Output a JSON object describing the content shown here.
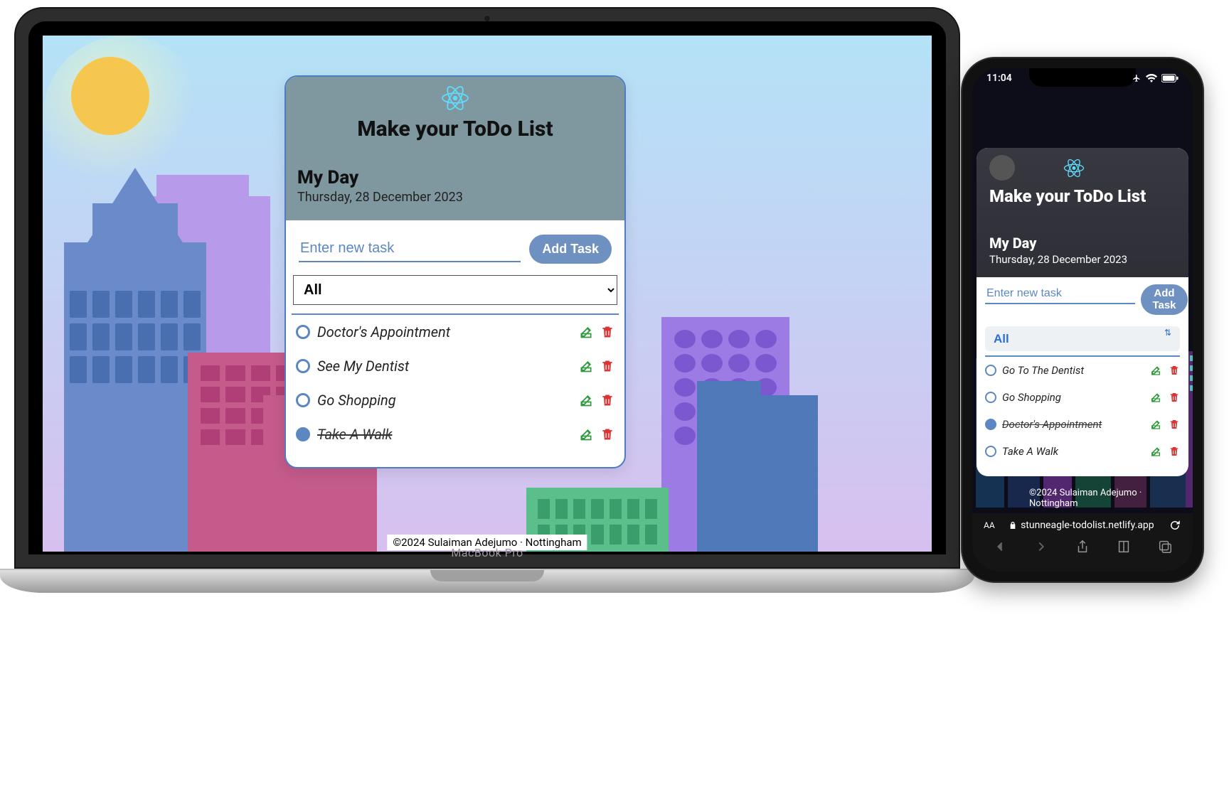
{
  "desktop": {
    "device_label": "MacBook Pro",
    "app_title": "Make your ToDo List",
    "section_title": "My Day",
    "date": "Thursday, 28 December 2023",
    "input_placeholder": "Enter new task",
    "add_button": "Add Task",
    "filter_value": "All",
    "footer": "©2024 Sulaiman Adejumo · Nottingham",
    "tasks": [
      {
        "text": "Doctor's Appointment",
        "done": false
      },
      {
        "text": "See My Dentist",
        "done": false
      },
      {
        "text": "Go Shopping",
        "done": false
      },
      {
        "text": "Take A Walk",
        "done": true
      }
    ]
  },
  "mobile": {
    "status_time": "11:04",
    "app_title": "Make your ToDo List",
    "section_title": "My Day",
    "date": "Thursday, 28 December 2023",
    "input_placeholder": "Enter new task",
    "add_button": "Add Task",
    "filter_value": "All",
    "footer_line1": "©2024 Sulaiman Adejumo ·",
    "footer_line2": "Nottingham",
    "url": "stunneagle-todolist.netlify.app",
    "tasks": [
      {
        "text": "Go To The Dentist",
        "done": false
      },
      {
        "text": "Go Shopping",
        "done": false
      },
      {
        "text": "Doctor's Appointment",
        "done": true
      },
      {
        "text": "Take A Walk",
        "done": false
      }
    ]
  }
}
